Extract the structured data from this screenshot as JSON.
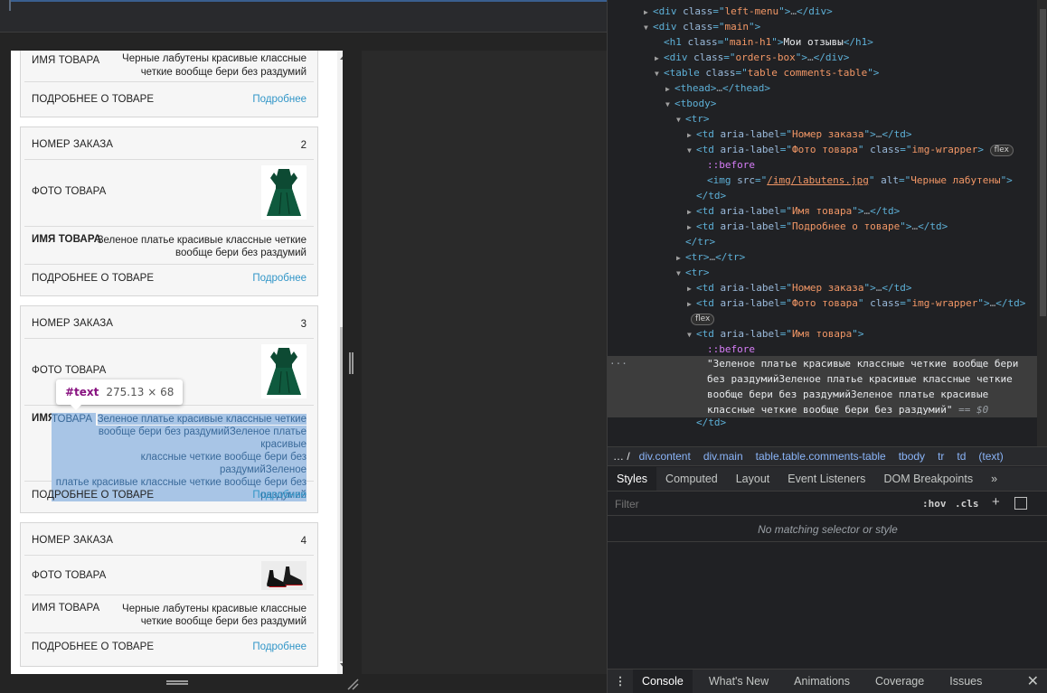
{
  "product": {
    "labels": {
      "order_number": "НОМЕР ЗАКАЗА",
      "photo": "ФОТО ТОВАРА",
      "name": "ИМЯ ТОВАРА",
      "name_part1": "ИМЯ",
      "name_part2": "ТОВАРА",
      "details": "ПОДРОБНЕЕ О ТОВАРЕ",
      "details_link": "Подробнее"
    },
    "card1": {
      "name_line1": "Черные лабутены красивые классные",
      "name_line2": "четкие вообще бери без раздумий"
    },
    "card2": {
      "order": "2",
      "name_line1": "Зеленое платье красивые классные четкие",
      "name_line2": "вообще бери без раздумий"
    },
    "card3": {
      "order": "3",
      "name_lines": [
        "Зеленое платье красивые классные четкие",
        "вообще бери без раздумийЗеленое платье красивые",
        "классные четкие вообще бери без раздумийЗеленое",
        "платье красивые классные четкие вообще бери без",
        "раздумий"
      ]
    },
    "card4": {
      "order": "4",
      "name_line1": "Черные лабутены красивые классные",
      "name_line2": "четкие вообще бери без раздумий"
    }
  },
  "tooltip": {
    "tag": "#text",
    "size": "275.13 × 68"
  },
  "elements": {
    "left_menu_class": "left-menu",
    "main_class": "main",
    "h1_class": "main-h1",
    "h1_text": "Мои отзывы",
    "orders_box_class": "orders-box",
    "table_class": "table comments-table",
    "aria_order": "Номер заказа",
    "aria_photo": "Фото товара",
    "img_wrapper_class": "img-wrapper",
    "aria_name": "Имя товара",
    "aria_details": "Подробнее о товаре",
    "img_src": "/img/labutens.jpg",
    "img_alt": "Черные лабутены",
    "badge_flex": "flex",
    "before": "::before",
    "text_node_lines": [
      "\"Зеленое платье красивые классные четкие вообще бери",
      "без раздумийЗеленое платье красивые классные четкие",
      "вообще бери без раздумийЗеленое платье красивые",
      "классные четкие вообще бери без раздумий\""
    ],
    "eq_sel": "== $0"
  },
  "breadcrumbs": [
    "div.content",
    "div.main",
    "table.table.comments-table",
    "tbody",
    "tr",
    "td",
    "(text)"
  ],
  "styles_tabs": [
    "Styles",
    "Computed",
    "Layout",
    "Event Listeners",
    "DOM Breakpoints"
  ],
  "styles_more": "»",
  "filter": {
    "placeholder": "Filter",
    "hov": ":hov",
    "cls": ".cls",
    "plus": "+"
  },
  "no_match": "No matching selector or style",
  "drawer_tabs": [
    "Console",
    "What's New",
    "Animations",
    "Coverage",
    "Issues"
  ],
  "colors": {
    "link": "#3296c8",
    "selection": "#a8c5e6",
    "tag": "#5db0d7",
    "attr_value": "#f29766",
    "pseudo": "#d67df7"
  }
}
